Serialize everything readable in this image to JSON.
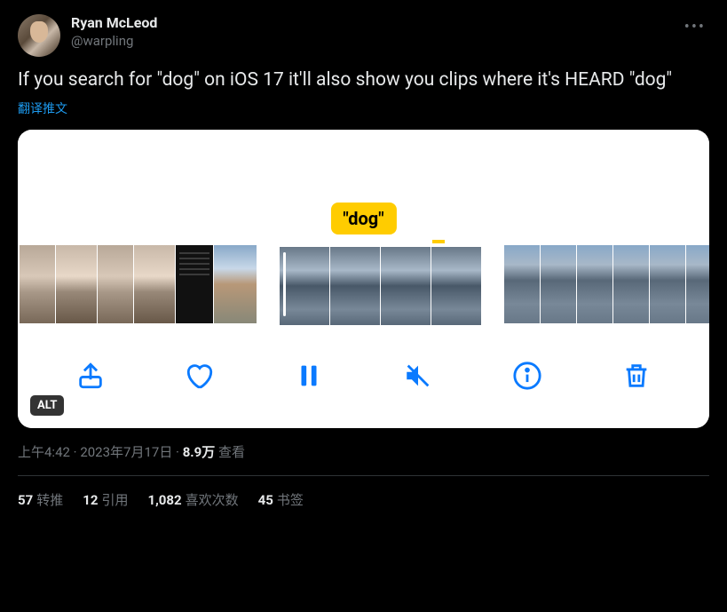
{
  "user": {
    "display_name": "Ryan McLeod",
    "handle": "@warpling"
  },
  "content_text": "If you search for \"dog\" on iOS 17 it'll also show you clips where it's HEARD \"dog\"",
  "translate_label": "翻译推文",
  "media": {
    "highlight_label": "\"dog\"",
    "alt_badge": "ALT",
    "toolbar_icons": {
      "share": "share-icon",
      "like": "heart-icon",
      "pause": "pause-icon",
      "mute": "mute-icon",
      "info": "info-icon",
      "delete": "trash-icon"
    }
  },
  "meta": {
    "time": "上午4:42",
    "date": "2023年7月17日",
    "separator": " · ",
    "views_count": "8.9万",
    "views_label": " 查看"
  },
  "stats": {
    "retweets": {
      "count": "57",
      "label": "转推"
    },
    "quotes": {
      "count": "12",
      "label": "引用"
    },
    "likes": {
      "count": "1,082",
      "label": "喜欢次数"
    },
    "bookmarks": {
      "count": "45",
      "label": "书签"
    }
  }
}
